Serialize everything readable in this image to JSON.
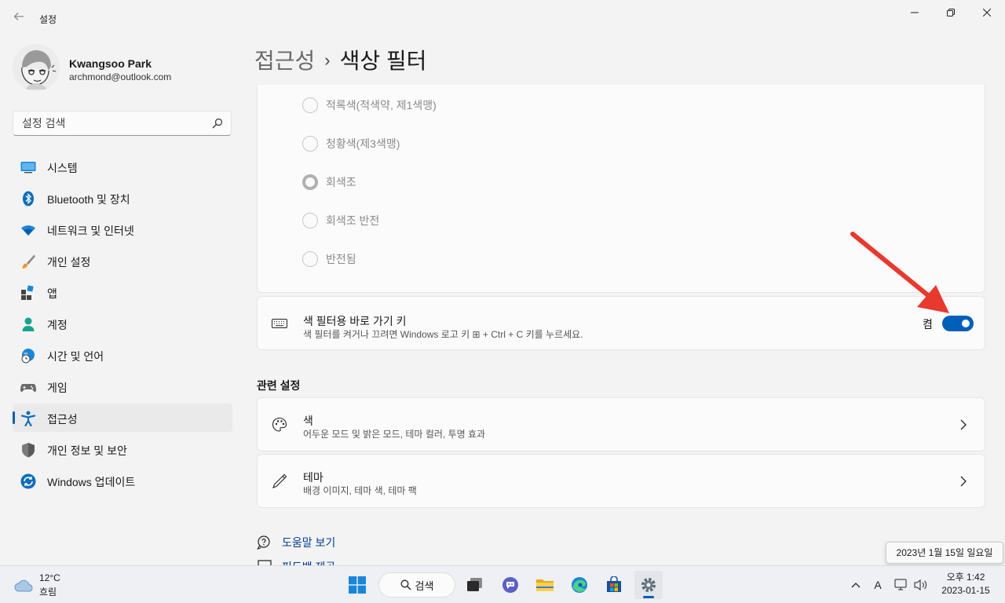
{
  "window": {
    "app_title": "설정"
  },
  "profile": {
    "name": "Kwangsoo Park",
    "email": "archmond@outlook.com"
  },
  "search": {
    "placeholder": "설정 검색"
  },
  "nav": {
    "items": [
      {
        "label": "시스템",
        "icon": "system-monitor-icon"
      },
      {
        "label": "Bluetooth 및 장치",
        "icon": "bluetooth-icon"
      },
      {
        "label": "네트워크 및 인터넷",
        "icon": "wifi-icon"
      },
      {
        "label": "개인 설정",
        "icon": "brush-icon"
      },
      {
        "label": "앱",
        "icon": "apps-icon"
      },
      {
        "label": "계정",
        "icon": "account-icon"
      },
      {
        "label": "시간 및 언어",
        "icon": "globe-clock-icon"
      },
      {
        "label": "게임",
        "icon": "gamepad-icon"
      },
      {
        "label": "접근성",
        "icon": "accessibility-icon",
        "selected": true
      },
      {
        "label": "개인 정보 및 보안",
        "icon": "shield-icon"
      },
      {
        "label": "Windows 업데이트",
        "icon": "update-icon"
      }
    ]
  },
  "header": {
    "parent": "접근성",
    "separator": "›",
    "current": "색상 필터"
  },
  "filters": {
    "options": [
      {
        "label": "적록색(적색약, 제1색맹)",
        "selected": false
      },
      {
        "label": "청황색(제3색맹)",
        "selected": false
      },
      {
        "label": "회색조",
        "selected": true
      },
      {
        "label": "회색조 반전",
        "selected": false
      },
      {
        "label": "반전됨",
        "selected": false
      }
    ]
  },
  "shortcut": {
    "title": "색 필터용 바로 가기 키",
    "subtitle": "색 필터를 켜거나 끄려면 Windows 로고 키 ⊞ + Ctrl + C 키를 누르세요.",
    "state_label": "켬",
    "enabled": true
  },
  "related": {
    "heading": "관련 설정",
    "items": [
      {
        "title": "색",
        "subtitle": "어두운 모드 및 밝은 모드, 테마 컬러, 투명 효과",
        "icon": "palette-icon"
      },
      {
        "title": "테마",
        "subtitle": "배경 이미지, 테마 색, 테마 팩",
        "icon": "pen-icon"
      }
    ]
  },
  "help": {
    "get_help": "도움말 보기",
    "feedback": "피드백 제공"
  },
  "tooltip": {
    "date_full": "2023년 1월 15일 일요일"
  },
  "taskbar": {
    "weather_temp": "12°C",
    "weather_cond": "흐림",
    "search_label": "검색",
    "clock_time": "오후 1:42",
    "clock_date": "2023-01-15",
    "ime": "A"
  },
  "colors": {
    "accent": "#005fb8",
    "annotation_arrow": "#e8392f"
  }
}
